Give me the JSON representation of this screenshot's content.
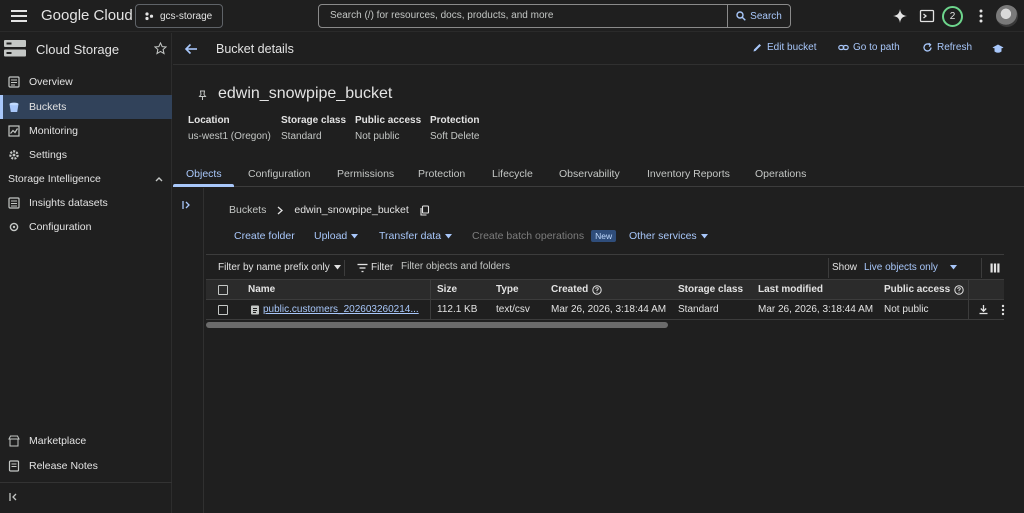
{
  "topbar": {
    "logo": "Google Cloud",
    "project": "gcs-storage",
    "search_placeholder": "Search (/) for resources, docs, products, and more",
    "search_button": "Search",
    "notifications_count": "2"
  },
  "sidebar": {
    "title": "Cloud Storage",
    "items": [
      {
        "label": "Overview",
        "icon": "overview-icon"
      },
      {
        "label": "Buckets",
        "icon": "bucket-icon",
        "active": true
      },
      {
        "label": "Monitoring",
        "icon": "monitoring-icon"
      },
      {
        "label": "Settings",
        "icon": "gear-icon"
      }
    ],
    "section": "Storage Intelligence",
    "section_items": [
      {
        "label": "Insights datasets",
        "icon": "insights-icon"
      },
      {
        "label": "Configuration",
        "icon": "configuration-icon"
      }
    ],
    "bottom_items": [
      {
        "label": "Marketplace",
        "icon": "marketplace-icon"
      },
      {
        "label": "Release Notes",
        "icon": "release-notes-icon"
      }
    ]
  },
  "header": {
    "title": "Bucket details",
    "actions": {
      "edit": "Edit bucket",
      "goto": "Go to path",
      "refresh": "Refresh"
    }
  },
  "bucket": {
    "name": "edwin_snowpipe_bucket",
    "meta": [
      {
        "label": "Location",
        "value": "us-west1 (Oregon)"
      },
      {
        "label": "Storage class",
        "value": "Standard"
      },
      {
        "label": "Public access",
        "value": "Not public"
      },
      {
        "label": "Protection",
        "value": "Soft Delete"
      }
    ]
  },
  "tabs": [
    "Objects",
    "Configuration",
    "Permissions",
    "Protection",
    "Lifecycle",
    "Observability",
    "Inventory Reports",
    "Operations"
  ],
  "breadcrumb": {
    "root": "Buckets",
    "current": "edwin_snowpipe_bucket"
  },
  "toolbar": {
    "create_folder": "Create folder",
    "upload": "Upload",
    "transfer": "Transfer data",
    "batch": "Create batch operations",
    "batch_badge": "New",
    "other": "Other services"
  },
  "filter": {
    "prefix": "Filter by name prefix only",
    "label": "Filter",
    "placeholder": "Filter objects and folders",
    "show_label": "Show",
    "show_value": "Live objects only"
  },
  "table": {
    "columns": [
      "Name",
      "Size",
      "Type",
      "Created",
      "Storage class",
      "Last modified",
      "Public access"
    ],
    "rows": [
      {
        "name": "public.customers_202603260214...",
        "size": "112.1 KB",
        "type": "text/csv",
        "created": "Mar 26, 2026, 3:18:44 AM",
        "storage_class": "Standard",
        "last_modified": "Mar 26, 2026, 3:18:44 AM",
        "public_access": "Not public"
      }
    ]
  },
  "colors": {
    "background": "#1f1f1f",
    "accent": "#a8c7fa",
    "active_nav": "#31425a",
    "badge_ring": "#6dd58c"
  }
}
